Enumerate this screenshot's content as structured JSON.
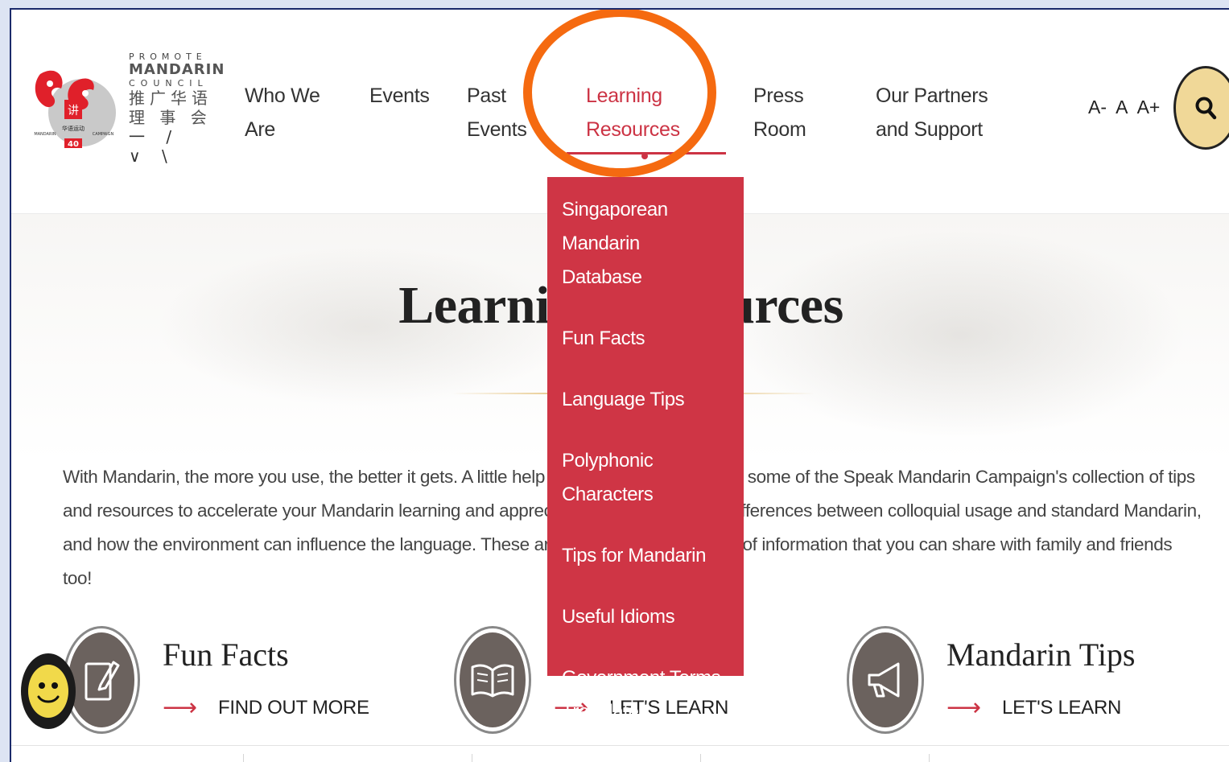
{
  "logo": {
    "line1": "PROMOTE",
    "line2": "MANDARIN",
    "line3": "COUNCIL",
    "line4": "推广华语",
    "line5": "理 事 会",
    "line6": "一 / ∨ \\",
    "mark_char": "讲",
    "mark_side_left": "MANDARIN",
    "mark_cn": "华语运动",
    "mark_side_right": "CAMPAIGN",
    "mark_num": "40"
  },
  "nav": {
    "who_we_are": "Who We Are",
    "events": "Events",
    "past_events": "Past Events",
    "learning_resources": "Learning Resources",
    "press_room": "Press Room",
    "partners": "Our Partners and Support",
    "font_small": "A-",
    "font_normal": "A",
    "font_large": "A+"
  },
  "dropdown": {
    "items": [
      "Singaporean Mandarin Database",
      "Fun Facts",
      "Language Tips",
      "Polyphonic Characters",
      "Tips for Mandarin",
      "Useful Idioms",
      "Government Terms Translated"
    ]
  },
  "main": {
    "title": "Learning Resources",
    "intro": "With Mandarin, the more you use, the better it gets. A little help goes a long way. Explore some of the Speak Mandarin Campaign's collection of tips and resources to accelerate your Mandarin learning and appreciation. Understand the differences between colloquial usage and standard Mandarin, and how the environment can influence the language. These are great bite-sized pieces of information that you can share with family and friends too!"
  },
  "cards": [
    {
      "title": "Fun Facts",
      "cta": "FIND OUT MORE",
      "icon": "notepad-icon"
    },
    {
      "title": "",
      "cta": "LET'S LEARN",
      "icon": "book-icon"
    },
    {
      "title": "Mandarin Tips",
      "cta": "LET'S LEARN",
      "icon": "megaphone-icon"
    }
  ],
  "colors": {
    "accent": "#cc3344",
    "dropdown_bg": "#cf3545",
    "annotation": "#f56a10",
    "search_bg": "#f0d898"
  }
}
